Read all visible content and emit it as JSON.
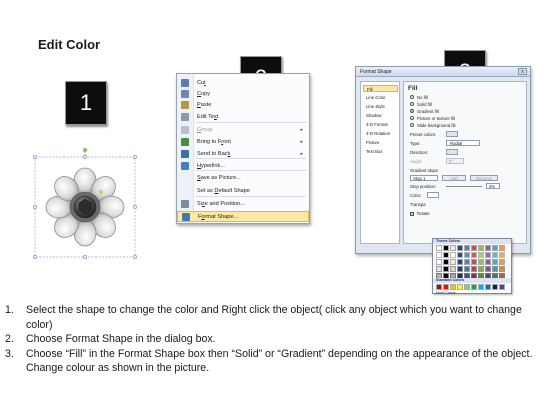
{
  "header": {
    "title": "Edit Color"
  },
  "badges": [
    "1",
    "2",
    "3"
  ],
  "context_menu": {
    "items": [
      {
        "pre": "Cu",
        "key": "t",
        "post": "",
        "icon": "scissors-icon",
        "color": "#5a7fb0",
        "disabled": false,
        "submenu": false
      },
      {
        "pre": "",
        "key": "C",
        "post": "opy",
        "icon": "copy-icon",
        "color": "#6f88ad",
        "disabled": false,
        "submenu": false
      },
      {
        "pre": "",
        "key": "P",
        "post": "aste",
        "icon": "paste-icon",
        "color": "#b89446",
        "disabled": false,
        "submenu": false
      },
      {
        "pre": "Edit Te",
        "key": "x",
        "post": "t",
        "icon": "text-icon",
        "color": "#8c99ad",
        "disabled": false,
        "submenu": false
      },
      {
        "pre": "",
        "key": "G",
        "post": "roup",
        "icon": "group-icon",
        "color": "#b9c0cc",
        "disabled": true,
        "submenu": true
      },
      {
        "pre": "Bring to F",
        "key": "r",
        "post": "ont",
        "icon": "bring-front-icon",
        "color": "#4f8a3e",
        "disabled": false,
        "submenu": true
      },
      {
        "pre": "Send to Bac",
        "key": "k",
        "post": "",
        "icon": "send-back-icon",
        "color": "#3f6fa8",
        "disabled": false,
        "submenu": true
      },
      {
        "pre": "",
        "key": "H",
        "post": "yperlink...",
        "icon": "hyperlink-icon",
        "color": "#3f7fc2",
        "disabled": false,
        "submenu": false
      },
      {
        "pre": "",
        "key": "S",
        "post": "ave as Picture...",
        "icon": "",
        "color": "",
        "disabled": false,
        "submenu": false
      },
      {
        "pre": "Set as ",
        "key": "D",
        "post": "efault Shape",
        "icon": "",
        "color": "",
        "disabled": false,
        "submenu": false
      },
      {
        "pre": "Si",
        "key": "z",
        "post": "e and Position...",
        "icon": "size-position-icon",
        "color": "#7a8aa3",
        "disabled": false,
        "submenu": false
      },
      {
        "pre": "F",
        "key": "o",
        "post": "rmat Shape...",
        "icon": "format-shape-icon",
        "color": "#4476b8",
        "disabled": false,
        "submenu": false
      }
    ]
  },
  "format_dialog": {
    "title": "Format Shape",
    "close": "x",
    "nav": [
      "Fill",
      "Line Color",
      "Line Style",
      "Shadow",
      "3-D Format",
      "3-D Rotation",
      "Picture",
      "Text Box"
    ],
    "section": "Fill",
    "options": [
      "No fill",
      "Solid fill",
      "Gradient fill",
      "Picture or texture fill",
      "Slide background fill"
    ],
    "selected_option": "Gradient fill",
    "fields": {
      "preset_colors": "Preset colors:",
      "type": "Type:",
      "type_value": "Radial",
      "direction": "Direction:",
      "angle": "Angle:",
      "angle_value": "0°",
      "gradient_stops": "Gradient stops",
      "stop_value": "Stop 1",
      "add": "Add",
      "remove": "Remove",
      "stop_position": "Stop position:",
      "stop_position_value": "0%",
      "color": "Color:",
      "transparency": "Transpa",
      "rotate": "Rotate"
    }
  },
  "palette": {
    "theme_header": "Theme Colors",
    "standard_header": "Standard Colors",
    "more_link": "More Colors...",
    "theme_row": [
      "#ffffff",
      "#000000",
      "#eeece1",
      "#1f497d",
      "#4f81bd",
      "#c0504d",
      "#9bbb59",
      "#8064a2",
      "#4bacc6",
      "#f79646"
    ],
    "standard_row": [
      "#c00000",
      "#ff0000",
      "#ffc000",
      "#ffff00",
      "#92d050",
      "#00b050",
      "#00b0f0",
      "#0070c0",
      "#002060",
      "#7030a0"
    ]
  },
  "instructions": [
    {
      "num": "1.",
      "text": "Select the shape to change the color and Right click the object( click any object which you want to change color)"
    },
    {
      "num": "2.",
      "text": "Choose Format Shape in the dialog box."
    },
    {
      "num": "3.",
      "text": "Choose “Fill” in the Format Shape box then “Solid” or “Gradient” depending on the appearance of the object. Change colour as shown in the picture."
    }
  ]
}
